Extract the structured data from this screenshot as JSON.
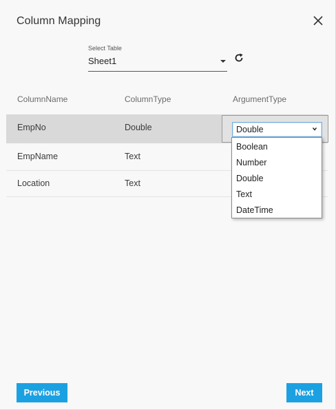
{
  "dialog": {
    "title": "Column Mapping"
  },
  "select_table": {
    "label": "Select Table",
    "value": "Sheet1"
  },
  "columns": {
    "name": "ColumnName",
    "type": "ColumnType",
    "argument": "ArgumentType"
  },
  "rows": [
    {
      "name": "EmpNo",
      "type": "Double",
      "argument": "Double"
    },
    {
      "name": "EmpName",
      "type": "Text",
      "argument": ""
    },
    {
      "name": "Location",
      "type": "Text",
      "argument": ""
    }
  ],
  "argument_dropdown": {
    "selected": "Double",
    "options": [
      "Boolean",
      "Number",
      "Double",
      "Text",
      "DateTime"
    ]
  },
  "buttons": {
    "previous": "Previous",
    "next": "Next"
  },
  "colors": {
    "accent": "#1ba1e2",
    "selected_row": "#d9d9d9",
    "background": "#f8f8f8"
  },
  "icons": {
    "close": "close-icon",
    "refresh": "refresh-icon",
    "caret": "chevron-down-icon"
  }
}
